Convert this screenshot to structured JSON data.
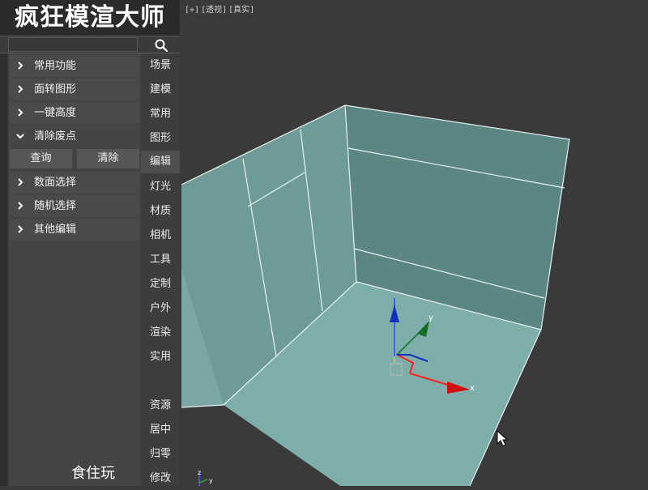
{
  "app": {
    "title": "疯狂模渲大师"
  },
  "search": {
    "icon": "search-icon"
  },
  "menu": {
    "items": [
      {
        "label": "常用功能",
        "expanded": false
      },
      {
        "label": "面转图形",
        "expanded": false
      },
      {
        "label": "一键高度",
        "expanded": false
      },
      {
        "label": "清除废点",
        "expanded": true
      },
      {
        "label": "数面选择",
        "expanded": false
      },
      {
        "label": "随机选择",
        "expanded": false
      },
      {
        "label": "其他编辑",
        "expanded": false
      }
    ],
    "sub_buttons": [
      "查询",
      "清除"
    ]
  },
  "categories": [
    "场景",
    "建模",
    "常用",
    "图形",
    "编辑",
    "灯光",
    "材质",
    "相机",
    "工具",
    "定制",
    "户外",
    "渲染",
    "实用",
    "资源",
    "居中",
    "归零",
    "修改"
  ],
  "active_category": "编辑",
  "footer": {
    "text": "食住玩"
  },
  "viewport": {
    "label_parts": [
      "[+]",
      "[透视]",
      "[真实]"
    ],
    "gizmo_axes": {
      "x": "x",
      "y": "y"
    },
    "corner_axes": {
      "y": "y",
      "z": "z"
    }
  },
  "colors": {
    "panel_bg": "#444444",
    "viewport_bg": "#3a3a3a",
    "floor": "#7eaeaa",
    "wall_left": "#6e9a98",
    "wall_back": "#5b8684",
    "axis_x": "#d01010",
    "axis_y": "#1a6a2a",
    "axis_z": "#1030c0"
  }
}
